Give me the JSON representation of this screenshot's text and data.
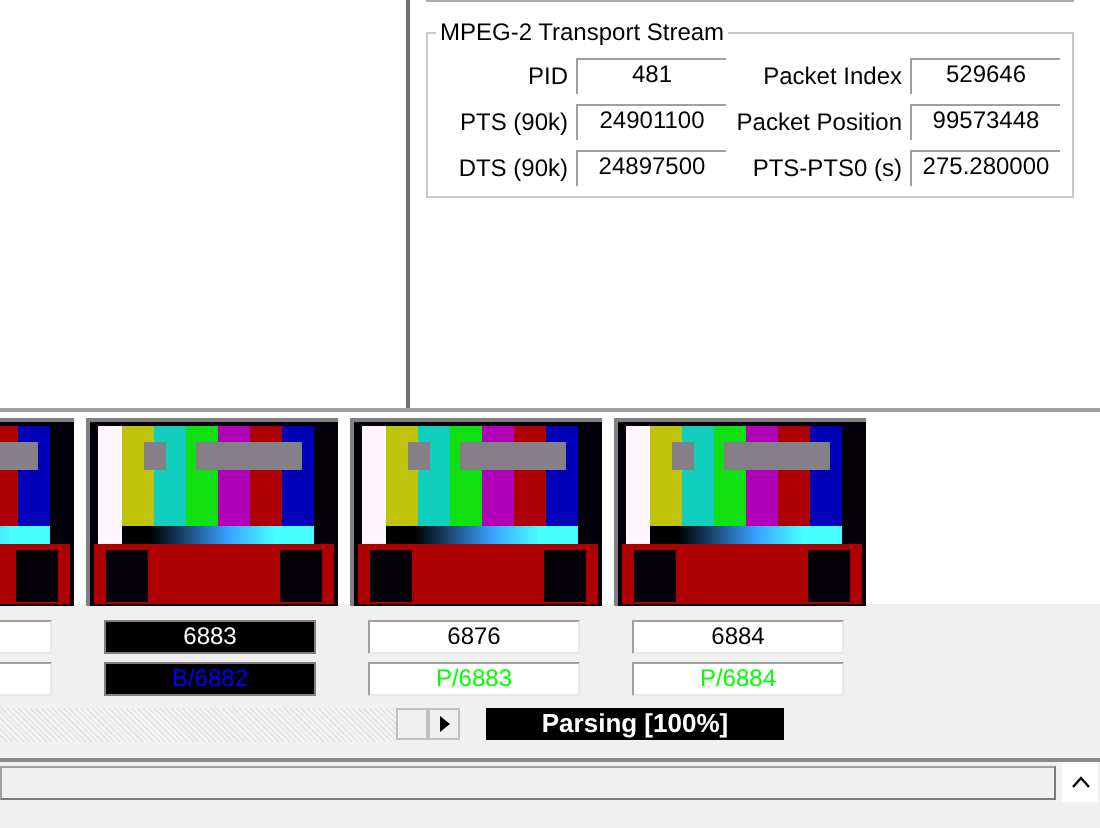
{
  "transport_stream": {
    "title": "MPEG-2 Transport Stream",
    "fields": [
      {
        "label": "PID",
        "value": "481"
      },
      {
        "label": "Packet Index",
        "value": "529646"
      },
      {
        "label": "PTS (90k)",
        "value": "24901100"
      },
      {
        "label": "Packet Position",
        "value": "99573448"
      },
      {
        "label": "DTS (90k)",
        "value": "24897500"
      },
      {
        "label": "PTS-PTS0 (s)",
        "value": "275.280000"
      }
    ]
  },
  "frames": [
    {
      "selected": false
    },
    {
      "selected": true,
      "number": "6883",
      "type": "B/6882",
      "kind": "b"
    },
    {
      "selected": false,
      "number": "6876",
      "type": "P/6883",
      "kind": "p"
    },
    {
      "selected": false,
      "number": "6884",
      "type": "P/6884",
      "kind": "p"
    }
  ],
  "progress": {
    "text": "Parsing [100%]"
  }
}
